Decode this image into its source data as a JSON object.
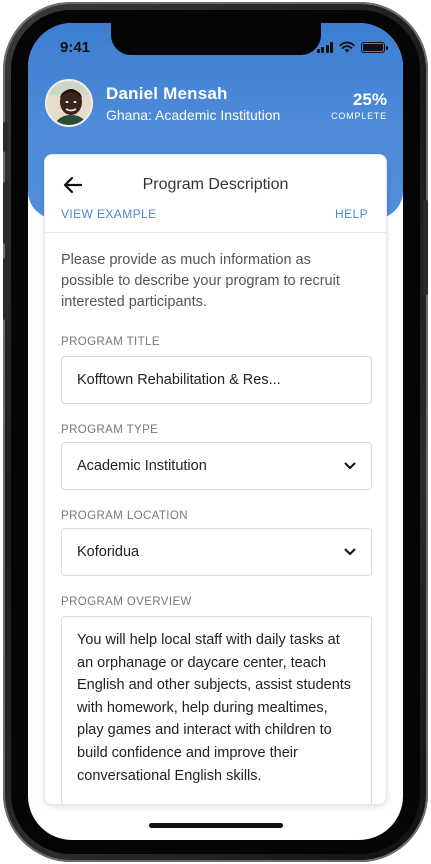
{
  "status_bar": {
    "time": "9:41"
  },
  "profile": {
    "name": "Daniel Mensah",
    "subtitle": "Ghana: Academic Institution",
    "progress_value": "25%",
    "progress_label": "COMPLETE"
  },
  "card": {
    "title": "Program Description",
    "view_example": "VIEW EXAMPLE",
    "help": "HELP",
    "intro": "Please provide as much information as possible to describe your program to recruit interested participants."
  },
  "fields": {
    "title": {
      "label": "PROGRAM TITLE",
      "value": "Kofftown Rehabilitation & Res..."
    },
    "type": {
      "label": "PROGRAM TYPE",
      "value": "Academic Institution"
    },
    "location": {
      "label": "PROGRAM LOCATION",
      "value": "Koforidua"
    },
    "overview": {
      "label": "PROGRAM OVERVIEW",
      "value": "You will help local staff with daily tasks at an orphanage or daycare center, teach English and other subjects, assist students with homework, help during mealtimes, play games and interact with children to build confidence and improve their conversational English skills."
    }
  },
  "icons": {
    "back": "arrow-left-icon",
    "dropdown": "chevron-down-icon",
    "signal": "cellular-signal-icon",
    "wifi": "wifi-icon",
    "battery": "battery-icon"
  },
  "colors": {
    "header": "#4a87d6",
    "link": "#4a87d6",
    "text": "#222222",
    "label": "#777777"
  }
}
